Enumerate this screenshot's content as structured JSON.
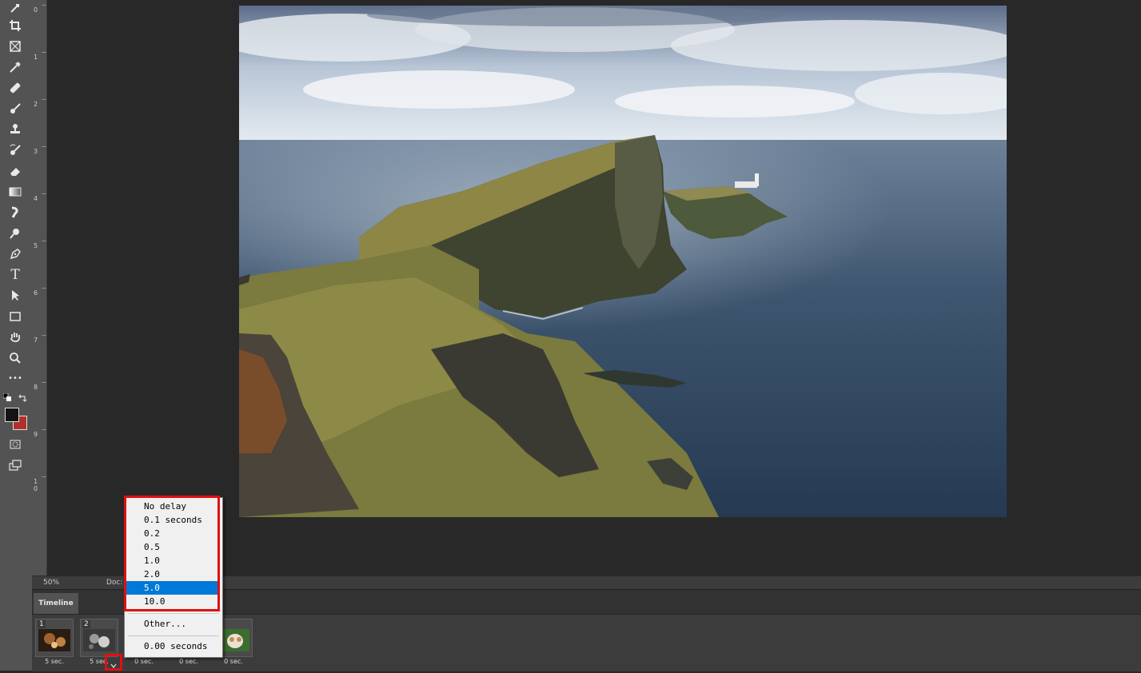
{
  "app": {
    "status": {
      "zoom": "50%",
      "doc_label": "Doc:"
    }
  },
  "toolbar": {
    "tools": [
      {
        "name": "move-icon"
      },
      {
        "name": "crop-icon"
      },
      {
        "name": "frame-icon"
      },
      {
        "name": "eyedropper-icon"
      },
      {
        "name": "healing-brush-icon"
      },
      {
        "name": "brush-icon"
      },
      {
        "name": "clone-stamp-icon"
      },
      {
        "name": "history-brush-icon"
      },
      {
        "name": "eraser-icon"
      },
      {
        "name": "gradient-icon"
      },
      {
        "name": "smudge-icon"
      },
      {
        "name": "dodge-icon"
      },
      {
        "name": "pen-icon"
      },
      {
        "name": "type-icon",
        "glyph": "T"
      },
      {
        "name": "path-selection-icon"
      },
      {
        "name": "rectangle-icon"
      },
      {
        "name": "hand-icon"
      },
      {
        "name": "zoom-icon"
      },
      {
        "name": "more-tools-icon",
        "glyph": "•••"
      }
    ],
    "foreground_color": "#141414",
    "background_color": "#b0312c"
  },
  "ruler": {
    "ticks": [
      "0",
      "1",
      "2",
      "3",
      "4",
      "5",
      "6",
      "7",
      "8",
      "9",
      "1\n0"
    ]
  },
  "timeline": {
    "tab_label": "Timeline",
    "frames": [
      {
        "num": "1",
        "delay": "5 sec."
      },
      {
        "num": "2",
        "delay": "5 sec."
      },
      {
        "num": "",
        "delay": "0 sec."
      },
      {
        "num": "",
        "delay": "0 sec."
      },
      {
        "num": "",
        "delay": "0 sec."
      }
    ]
  },
  "delay_menu": {
    "items": [
      "No delay",
      "0.1 seconds",
      "0.2",
      "0.5",
      "1.0",
      "2.0",
      "5.0",
      "10.0"
    ],
    "selected": "5.0",
    "other": "Other...",
    "current": "0.00 seconds"
  }
}
